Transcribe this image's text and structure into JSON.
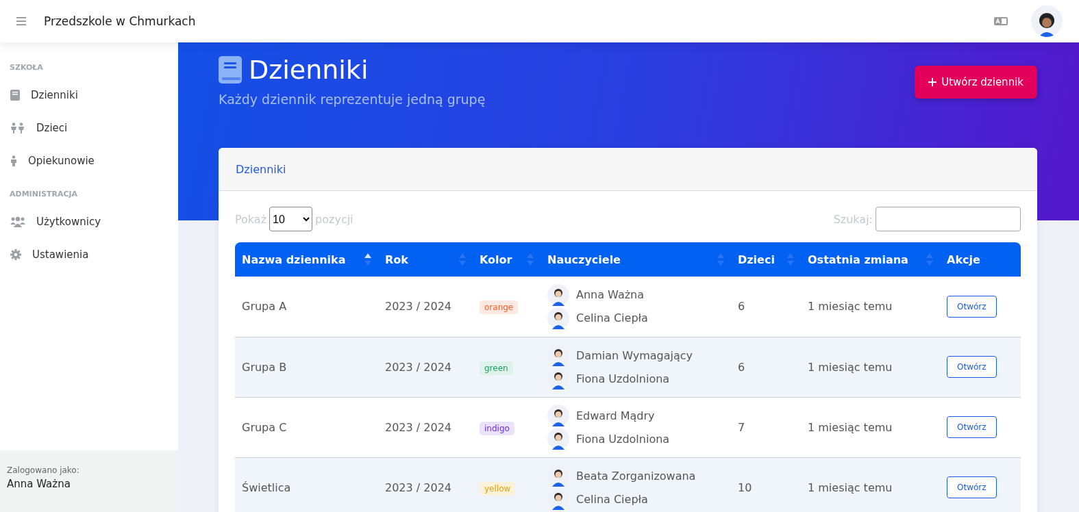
{
  "topbar": {
    "title": "Przedszkole w Chmurkach"
  },
  "sidebar": {
    "sections": [
      {
        "heading": "SZKOŁA",
        "items": [
          {
            "label": "Dzienniki"
          },
          {
            "label": "Dzieci"
          },
          {
            "label": "Opiekunowie"
          }
        ]
      },
      {
        "heading": "ADMINISTRACJA",
        "items": [
          {
            "label": "Użytkownicy"
          },
          {
            "label": "Ustawienia"
          }
        ]
      }
    ],
    "footer": {
      "caption": "Zalogowano jako:",
      "user": "Anna Ważna"
    }
  },
  "page": {
    "title": "Dzienniki",
    "subtitle": "Każdy dziennik reprezentuje jedną grupę",
    "create_button": "Utwórz dziennik"
  },
  "card": {
    "title": "Dzienniki",
    "length_prefix": "Pokaż",
    "length_value": "10",
    "length_suffix": "pozycji",
    "search_label": "Szukaj:"
  },
  "table": {
    "columns": [
      {
        "label": "Nazwa dziennika",
        "sortable": true,
        "sorted": true
      },
      {
        "label": "Rok",
        "sortable": true,
        "sorted": false
      },
      {
        "label": "Kolor",
        "sortable": true,
        "sorted": false
      },
      {
        "label": "Nauczyciele",
        "sortable": true,
        "sorted": false
      },
      {
        "label": "Dzieci",
        "sortable": true,
        "sorted": false
      },
      {
        "label": "Ostatnia zmiana",
        "sortable": true,
        "sorted": false
      },
      {
        "label": "Akcje",
        "sortable": false
      }
    ],
    "rows": [
      {
        "name": "Grupa A",
        "year": "2023 / 2024",
        "tag": "orange",
        "color": "#f0602a",
        "teachers": [
          "Anna Ważna",
          "Celina Ciepła"
        ],
        "children": "6",
        "changed": "1 miesiąc temu",
        "action": "Otwórz"
      },
      {
        "name": "Grupa B",
        "year": "2023 / 2024",
        "tag": "green",
        "color": "#1aa163",
        "teachers": [
          "Damian Wymagający",
          "Fiona Uzdolniona"
        ],
        "children": "6",
        "changed": "1 miesiąc temu",
        "action": "Otwórz"
      },
      {
        "name": "Grupa C",
        "year": "2023 / 2024",
        "tag": "indigo",
        "color": "#6f2fe0",
        "teachers": [
          "Edward Mądry",
          "Fiona Uzdolniona"
        ],
        "children": "7",
        "changed": "1 miesiąc temu",
        "action": "Otwórz"
      },
      {
        "name": "Świetlica",
        "year": "2023 / 2024",
        "tag": "yellow",
        "color": "#e8a200",
        "teachers": [
          "Beata Zorganizowana",
          "Celina Ciepła"
        ],
        "children": "10",
        "changed": "1 miesiąc temu",
        "action": "Otwórz"
      }
    ]
  }
}
